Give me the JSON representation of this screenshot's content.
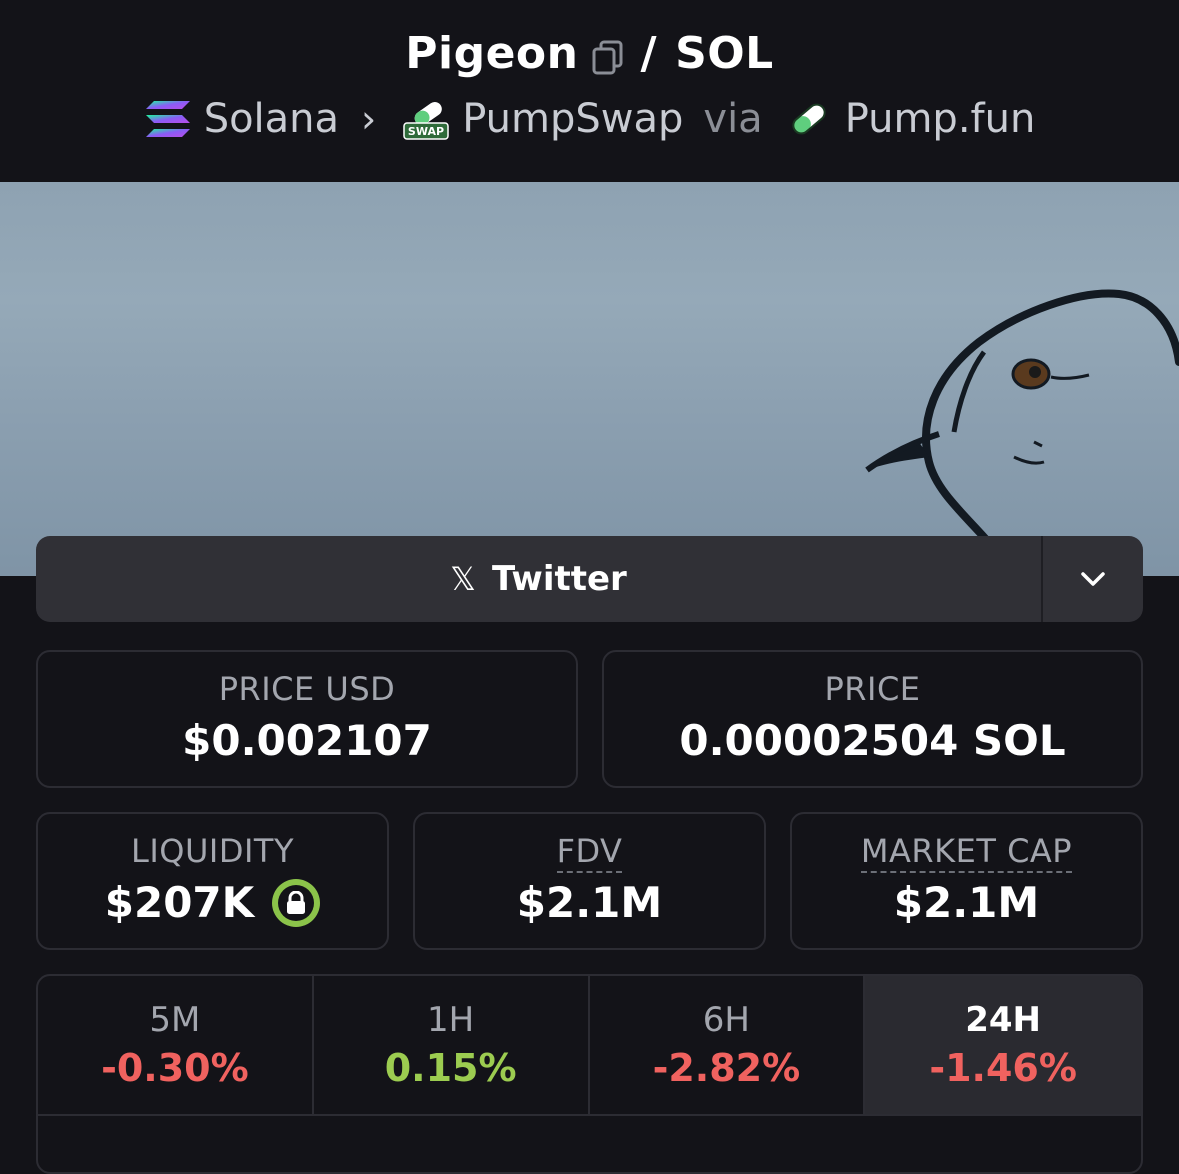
{
  "header": {
    "token": "Pigeon",
    "separator": "/",
    "quote": "SOL",
    "chain": "Solana",
    "dex": "PumpSwap",
    "via": "via",
    "launchpad": "Pump.fun",
    "dex_badge": "SWAP"
  },
  "social": {
    "twitter_label": "Twitter",
    "x_glyph": "𝕏"
  },
  "stats": {
    "price_usd_label": "PRICE USD",
    "price_usd": "$0.002107",
    "price_label": "PRICE",
    "price": "0.00002504 SOL",
    "liquidity_label": "LIQUIDITY",
    "liquidity": "$207K",
    "fdv_label": "FDV",
    "fdv": "$2.1M",
    "mcap_label": "MARKET CAP",
    "mcap": "$2.1M"
  },
  "timeframes": [
    {
      "period": "5M",
      "change": "-0.30%"
    },
    {
      "period": "1H",
      "change": "0.15%"
    },
    {
      "period": "6H",
      "change": "-2.82%"
    },
    {
      "period": "24H",
      "change": "-1.46%"
    }
  ],
  "colors": {
    "negative": "#f0625f",
    "positive": "#9ccc50",
    "lock_ring": "#8bc34a"
  }
}
